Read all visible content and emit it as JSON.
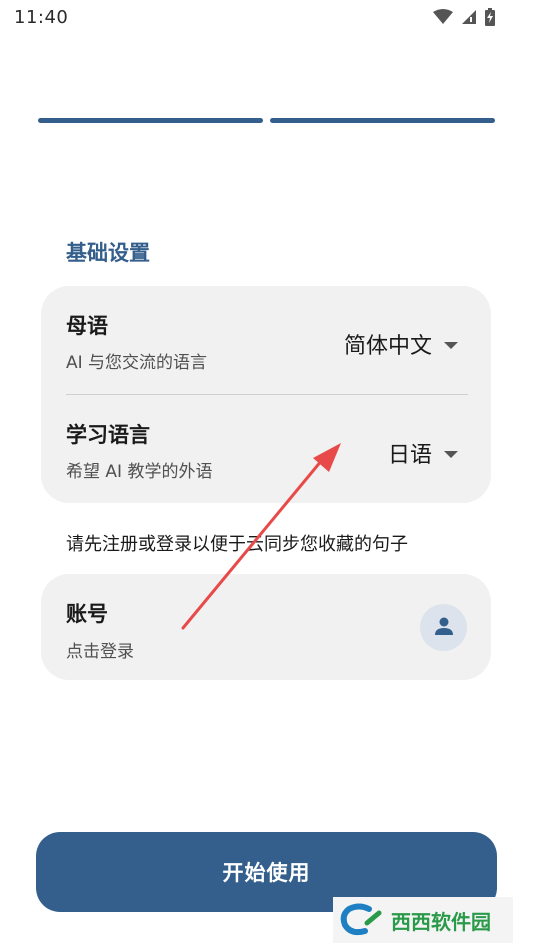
{
  "status_bar": {
    "time": "11:40"
  },
  "settings": {
    "section_title": "基础设置",
    "native_language": {
      "title": "母语",
      "subtitle": "AI 与您交流的语言",
      "value": "简体中文"
    },
    "learning_language": {
      "title": "学习语言",
      "subtitle": "希望 AI 教学的外语",
      "value": "日语"
    }
  },
  "note": "请先注册或登录以便于云同步您收藏的句子",
  "account": {
    "title": "账号",
    "subtitle": "点击登录"
  },
  "start_button": {
    "label": "开始使用"
  },
  "watermark": {
    "text": "西西软件园"
  },
  "colors": {
    "primary": "#345f8c",
    "card_bg": "#f1f1f1",
    "annotation_arrow": "#e84a4a"
  },
  "icons": {
    "wifi": "wifi-icon",
    "signal": "signal-icon",
    "battery": "battery-charging-icon",
    "avatar": "person-icon",
    "dropdown": "chevron-down-icon"
  }
}
